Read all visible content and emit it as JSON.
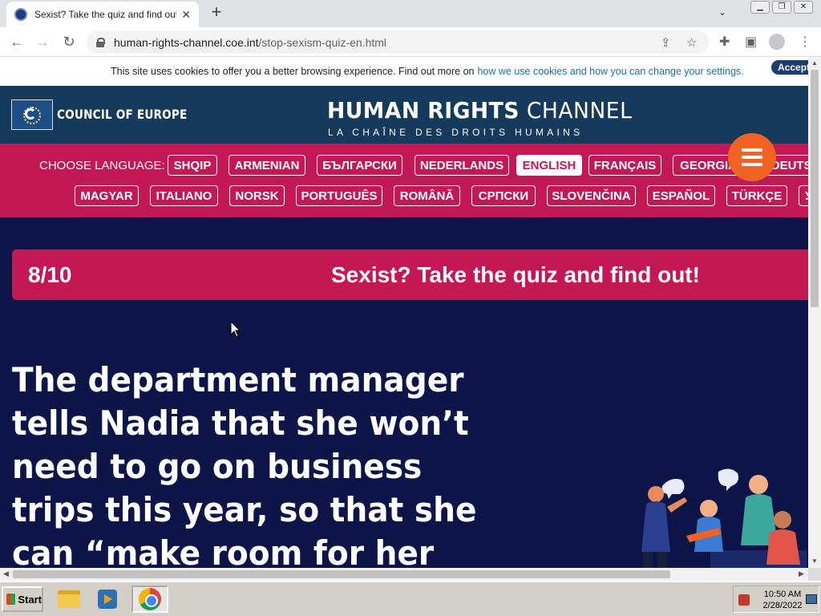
{
  "browser": {
    "tab_title": "Sexist? Take the quiz and find out!",
    "tab_close": "✕",
    "new_tab": "+",
    "url_host": "human-rights-channel.coe.int",
    "url_path": "/stop-sexism-quiz-en.html"
  },
  "cookie": {
    "text": "This site uses cookies to offer you a better browsing experience. Find out more on",
    "link": "how we use cookies and how you can change your settings.",
    "accept": "Accept"
  },
  "header": {
    "org_name": "COUNCIL OF EUROPE",
    "title_bold": "HUMAN RIGHTS",
    "title_light": " CHANNEL",
    "subtitle": "LA CHAÎNE DES DROITS HUMAINS"
  },
  "languages": {
    "label": "CHOOSE LANGUAGE:",
    "row1": [
      "SHQIP",
      "ARMENIAN",
      "БЪЛГАРСКИ",
      "NEDERLANDS",
      "ENGLISH",
      "FRANÇAIS",
      "GEORGIAN",
      "DEUTSCH"
    ],
    "row2": [
      "MAGYAR",
      "ITALIANO",
      "NORSK",
      "PORTUGUÊS",
      "ROMÂNĂ",
      "СРПСКИ",
      "SLOVENČINA",
      "ESPAÑOL",
      "TÜRKÇE",
      "УКРАЇНСЬКА"
    ],
    "selected": "ENGLISH"
  },
  "quiz": {
    "progress": "8/10",
    "title": "Sexist? Take the quiz and find out!",
    "question": "The department manager tells Nadia that she won’t need to go on business trips this year, so that she can “make room for her family life”"
  },
  "taskbar": {
    "start": "Start",
    "time": "10:50 AM",
    "date": "2/28/2022"
  },
  "colors": {
    "header": "#153a5b",
    "accent": "#c31854",
    "page_bg": "#0c1448",
    "menu_button": "#f06322"
  }
}
